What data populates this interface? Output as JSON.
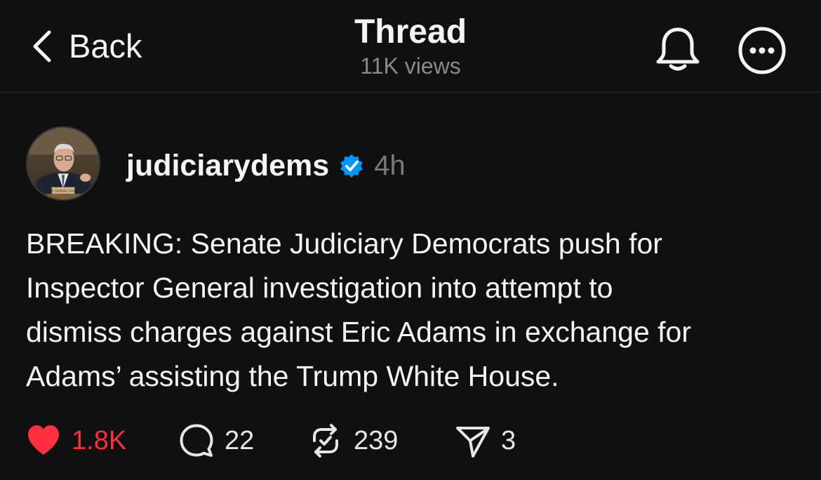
{
  "header": {
    "back_label": "Back",
    "title": "Thread",
    "views": "11K views",
    "icons": {
      "back": "chevron-left-icon",
      "notifications": "bell-icon",
      "more": "more-icon"
    }
  },
  "post": {
    "avatar_caption": "MR. DURBIN CHAIR",
    "username": "judiciarydems",
    "verified": true,
    "time": "4h",
    "text": "BREAKING: Senate Judiciary Democrats push for\nInspector General investigation into attempt to\ndismiss charges against Eric Adams in exchange for\nAdams’ assisting the Trump White House.",
    "actions": {
      "likes": "1.8K",
      "liked": true,
      "replies": "22",
      "reposts": "239",
      "shares": "3"
    }
  },
  "colors": {
    "background": "#101010",
    "text": "#f3f5f7",
    "muted": "#7a7a7a",
    "like": "#ff3040",
    "verified": "#0095f6"
  }
}
